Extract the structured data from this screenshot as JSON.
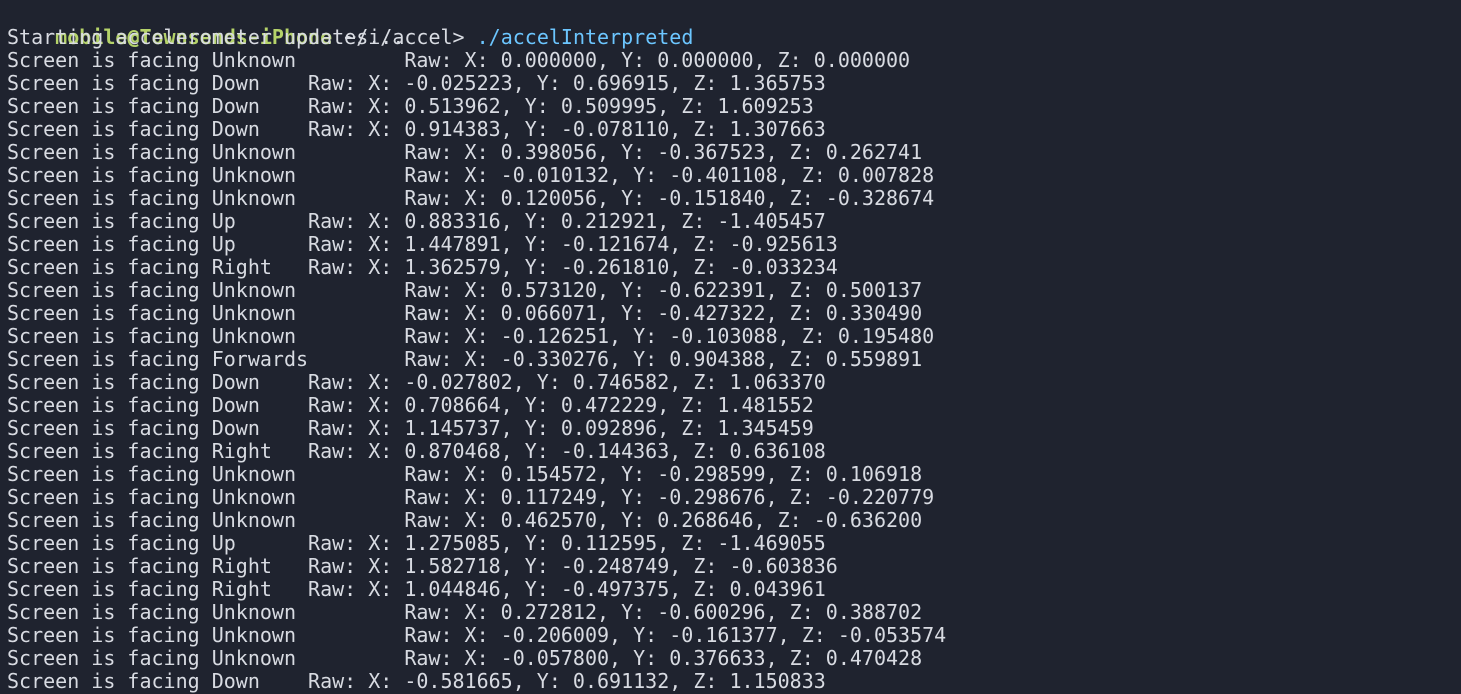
{
  "terminal": {
    "prompt": {
      "userhost": "mobile@Townsends-iPhone",
      "path": " ~/i/accel> ",
      "command": "./accelInterpreted"
    },
    "lines": [
      "Starting accelerometer updates...",
      "Screen is facing Unknown         Raw: X: 0.000000, Y: 0.000000, Z: 0.000000",
      "Screen is facing Down    Raw: X: -0.025223, Y: 0.696915, Z: 1.365753",
      "Screen is facing Down    Raw: X: 0.513962, Y: 0.509995, Z: 1.609253",
      "Screen is facing Down    Raw: X: 0.914383, Y: -0.078110, Z: 1.307663",
      "Screen is facing Unknown         Raw: X: 0.398056, Y: -0.367523, Z: 0.262741",
      "Screen is facing Unknown         Raw: X: -0.010132, Y: -0.401108, Z: 0.007828",
      "Screen is facing Unknown         Raw: X: 0.120056, Y: -0.151840, Z: -0.328674",
      "Screen is facing Up      Raw: X: 0.883316, Y: 0.212921, Z: -1.405457",
      "Screen is facing Up      Raw: X: 1.447891, Y: -0.121674, Z: -0.925613",
      "Screen is facing Right   Raw: X: 1.362579, Y: -0.261810, Z: -0.033234",
      "Screen is facing Unknown         Raw: X: 0.573120, Y: -0.622391, Z: 0.500137",
      "Screen is facing Unknown         Raw: X: 0.066071, Y: -0.427322, Z: 0.330490",
      "Screen is facing Unknown         Raw: X: -0.126251, Y: -0.103088, Z: 0.195480",
      "Screen is facing Forwards        Raw: X: -0.330276, Y: 0.904388, Z: 0.559891",
      "Screen is facing Down    Raw: X: -0.027802, Y: 0.746582, Z: 1.063370",
      "Screen is facing Down    Raw: X: 0.708664, Y: 0.472229, Z: 1.481552",
      "Screen is facing Down    Raw: X: 1.145737, Y: 0.092896, Z: 1.345459",
      "Screen is facing Right   Raw: X: 0.870468, Y: -0.144363, Z: 0.636108",
      "Screen is facing Unknown         Raw: X: 0.154572, Y: -0.298599, Z: 0.106918",
      "Screen is facing Unknown         Raw: X: 0.117249, Y: -0.298676, Z: -0.220779",
      "Screen is facing Unknown         Raw: X: 0.462570, Y: 0.268646, Z: -0.636200",
      "Screen is facing Up      Raw: X: 1.275085, Y: 0.112595, Z: -1.469055",
      "Screen is facing Right   Raw: X: 1.582718, Y: -0.248749, Z: -0.603836",
      "Screen is facing Right   Raw: X: 1.044846, Y: -0.497375, Z: 0.043961",
      "Screen is facing Unknown         Raw: X: 0.272812, Y: -0.600296, Z: 0.388702",
      "Screen is facing Unknown         Raw: X: -0.206009, Y: -0.161377, Z: -0.053574",
      "Screen is facing Unknown         Raw: X: -0.057800, Y: 0.376633, Z: 0.470428",
      "Screen is facing Down    Raw: X: -0.581665, Y: 0.691132, Z: 1.150833"
    ]
  }
}
